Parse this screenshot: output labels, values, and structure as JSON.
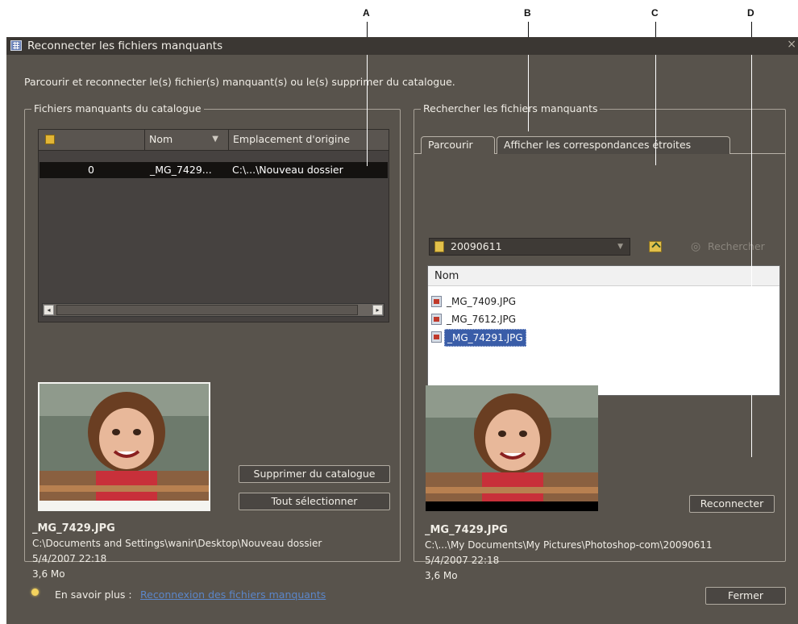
{
  "callouts": [
    "A",
    "B",
    "C",
    "D"
  ],
  "window": {
    "title": "Reconnecter les fichiers manquants",
    "close": "×"
  },
  "intro": "Parcourir et reconnecter le(s) fichier(s) manquant(s) ou le(s) supprimer du catalogue.",
  "left": {
    "legend": "Fichiers manquants du catalogue",
    "columns": {
      "icon": "icon",
      "name": "Nom",
      "sort": "▼",
      "location": "Emplacement d'origine"
    },
    "rows": [
      {
        "num": "0",
        "name": "_MG_7429...",
        "location": "C:\\...\\Nouveau dossier"
      }
    ],
    "scroll_left": "◂",
    "scroll_right": "▸",
    "buttons": {
      "delete": "Supprimer du catalogue",
      "select_all": "Tout sélectionner"
    },
    "info": {
      "filename": "_MG_7429.JPG",
      "path": "C:\\Documents and Settings\\wanir\\Desktop\\Nouveau dossier",
      "date": "5/4/2007 22:18",
      "size": "3,6 Mo"
    }
  },
  "right": {
    "legend": "Rechercher les fichiers manquants",
    "tabs": {
      "browse": "Parcourir",
      "matches": "Afficher les correspondances étroites"
    },
    "folder": "20090611",
    "dropdown": "▼",
    "search": "Rechercher",
    "list_header": "Nom",
    "files": [
      "_MG_7409.JPG",
      "_MG_7612.JPG",
      "_MG_74291.JPG"
    ],
    "reconnect": "Reconnecter",
    "info": {
      "filename": "_MG_7429.JPG",
      "path": "C:\\...\\My Documents\\My Pictures\\Photoshop-com\\20090611",
      "date": "5/4/2007 22:18",
      "size": "3,6 Mo"
    }
  },
  "footer": {
    "label": "En savoir plus :",
    "link": "Reconnexion des fichiers manquants",
    "close": "Fermer"
  },
  "colors": {
    "dialog": "#58534c",
    "selection": "#141210",
    "link": "#5b86c9",
    "file_selected": "#3a5da8"
  }
}
